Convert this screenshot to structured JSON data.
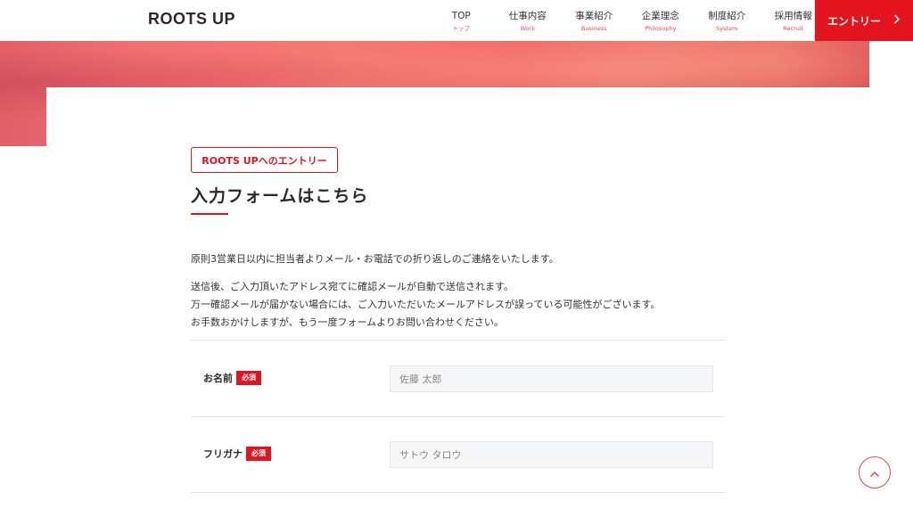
{
  "header": {
    "logo": "ROOTS UP",
    "nav": [
      {
        "jp": "TOP",
        "en": "トップ"
      },
      {
        "jp": "仕事内容",
        "en": "Work"
      },
      {
        "jp": "事業紹介",
        "en": "Business"
      },
      {
        "jp": "企業理念",
        "en": "Philosophy"
      },
      {
        "jp": "制度紹介",
        "en": "System"
      },
      {
        "jp": "採用情報",
        "en": "Recruit"
      }
    ],
    "entry_label": "エントリー"
  },
  "section": {
    "tag": "ROOTS UPへのエントリー",
    "title": "入力フォームはこちら",
    "paragraph1": "原則3営業日以内に担当者よりメール・お電話での折り返しのご連絡をいたします。",
    "paragraph2": [
      "送信後、ご入力頂いたアドレス宛てに確認メールが自動で送信されます。",
      "万一確認メールが届かない場合には、ご入力いただいたメールアドレスが誤っている可能性がございます。",
      "お手数おかけしますが、もう一度フォームよりお問い合わせください。"
    ]
  },
  "form": {
    "required_label": "必須",
    "fields": [
      {
        "label": "お名前",
        "placeholder": "佐藤 太郎"
      },
      {
        "label": "フリガナ",
        "placeholder": "サトウ タロウ"
      }
    ]
  },
  "colors": {
    "accent": "#e3141e",
    "nav_sub": "#e9464d"
  }
}
